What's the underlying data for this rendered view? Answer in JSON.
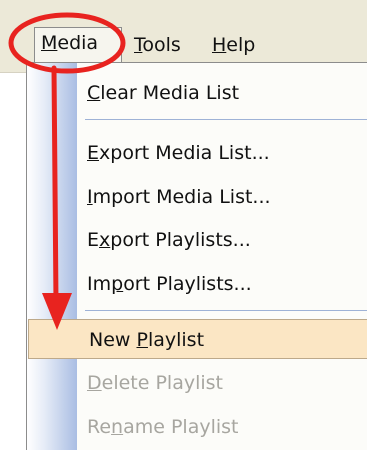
{
  "menubar": {
    "items": [
      {
        "accel": "M",
        "rest": "edia"
      },
      {
        "accel": "T",
        "rest": "ools"
      },
      {
        "accel": "H",
        "rest": "elp"
      }
    ]
  },
  "dropdown": {
    "items": [
      {
        "pre": "",
        "accel": "C",
        "post": "lear Media List",
        "state": "enabled"
      },
      {
        "pre": "",
        "accel": "E",
        "post": "xport Media List...",
        "state": "enabled"
      },
      {
        "pre": "",
        "accel": "I",
        "post": "mport Media List...",
        "state": "enabled"
      },
      {
        "pre": "E",
        "accel": "x",
        "post": "port Playlists...",
        "state": "enabled"
      },
      {
        "pre": "Im",
        "accel": "p",
        "post": "ort Playlists...",
        "state": "enabled"
      },
      {
        "pre": "New ",
        "accel": "P",
        "post": "laylist",
        "state": "highlighted"
      },
      {
        "pre": "",
        "accel": "D",
        "post": "elete Playlist",
        "state": "disabled"
      },
      {
        "pre": "Re",
        "accel": "n",
        "post": "ame Playlist",
        "state": "disabled"
      }
    ]
  },
  "colors": {
    "menubar_bg": "#ece9d8",
    "highlight_bg": "#fbe6c4",
    "disabled_text": "#a7a6a0",
    "annotation": "#e8231f"
  }
}
